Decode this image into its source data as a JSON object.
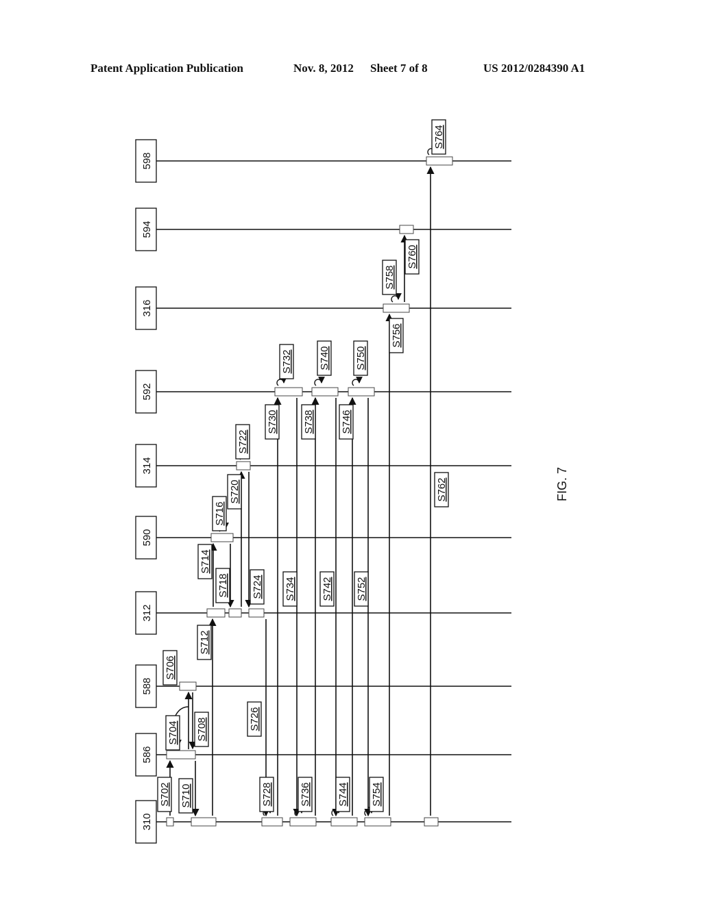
{
  "header": {
    "publication": "Patent Application Publication",
    "date": "Nov. 8, 2012",
    "sheet": "Sheet 7 of 8",
    "number": "US 2012/0284390 A1"
  },
  "figure_label": "FIG. 7",
  "lifelines": [
    {
      "id": "310",
      "label": "310"
    },
    {
      "id": "586",
      "label": "586"
    },
    {
      "id": "588",
      "label": "588"
    },
    {
      "id": "312",
      "label": "312"
    },
    {
      "id": "590",
      "label": "590"
    },
    {
      "id": "314",
      "label": "314"
    },
    {
      "id": "592",
      "label": "592"
    },
    {
      "id": "316",
      "label": "316"
    },
    {
      "id": "594",
      "label": "594"
    },
    {
      "id": "598",
      "label": "598"
    }
  ],
  "messages": [
    {
      "step": "S702",
      "from": "310",
      "to": "586"
    },
    {
      "step": "S704",
      "from": "586",
      "to": "586",
      "kind": "self"
    },
    {
      "step": "S706",
      "from": "586",
      "to": "588"
    },
    {
      "step": "S708",
      "from": "588",
      "to": "586"
    },
    {
      "step": "S710",
      "from": "586",
      "to": "310"
    },
    {
      "step": "S712",
      "from": "310",
      "to": "312"
    },
    {
      "step": "S714",
      "from": "312",
      "to": "590"
    },
    {
      "step": "S716",
      "from": "590",
      "to": "590",
      "kind": "self"
    },
    {
      "step": "S718",
      "from": "590",
      "to": "312"
    },
    {
      "step": "S720",
      "from": "312",
      "to": "314"
    },
    {
      "step": "S722",
      "from": "314",
      "to": "314",
      "kind": "self"
    },
    {
      "step": "S724",
      "from": "314",
      "to": "312"
    },
    {
      "step": "S726",
      "from": "312",
      "to": "310"
    },
    {
      "step": "S728",
      "from": "310",
      "to": "310",
      "kind": "self"
    },
    {
      "step": "S730",
      "from": "310",
      "to": "592"
    },
    {
      "step": "S732",
      "from": "592",
      "to": "592",
      "kind": "self"
    },
    {
      "step": "S734",
      "from": "592",
      "to": "310"
    },
    {
      "step": "S736",
      "from": "310",
      "to": "310",
      "kind": "self"
    },
    {
      "step": "S738",
      "from": "310",
      "to": "592"
    },
    {
      "step": "S740",
      "from": "592",
      "to": "592",
      "kind": "self"
    },
    {
      "step": "S742",
      "from": "592",
      "to": "310"
    },
    {
      "step": "S744",
      "from": "310",
      "to": "310",
      "kind": "self"
    },
    {
      "step": "S746",
      "from": "310",
      "to": "592"
    },
    {
      "step": "S750",
      "from": "592",
      "to": "592",
      "kind": "self"
    },
    {
      "step": "S752",
      "from": "592",
      "to": "310"
    },
    {
      "step": "S754",
      "from": "310",
      "to": "310",
      "kind": "self"
    },
    {
      "step": "S756",
      "from": "310",
      "to": "316"
    },
    {
      "step": "S758",
      "from": "316",
      "to": "316",
      "kind": "self"
    },
    {
      "step": "S760",
      "from": "316",
      "to": "594"
    },
    {
      "step": "S762",
      "from": "310",
      "to": "598"
    },
    {
      "step": "S764",
      "from": "598",
      "to": "598",
      "kind": "self"
    }
  ]
}
